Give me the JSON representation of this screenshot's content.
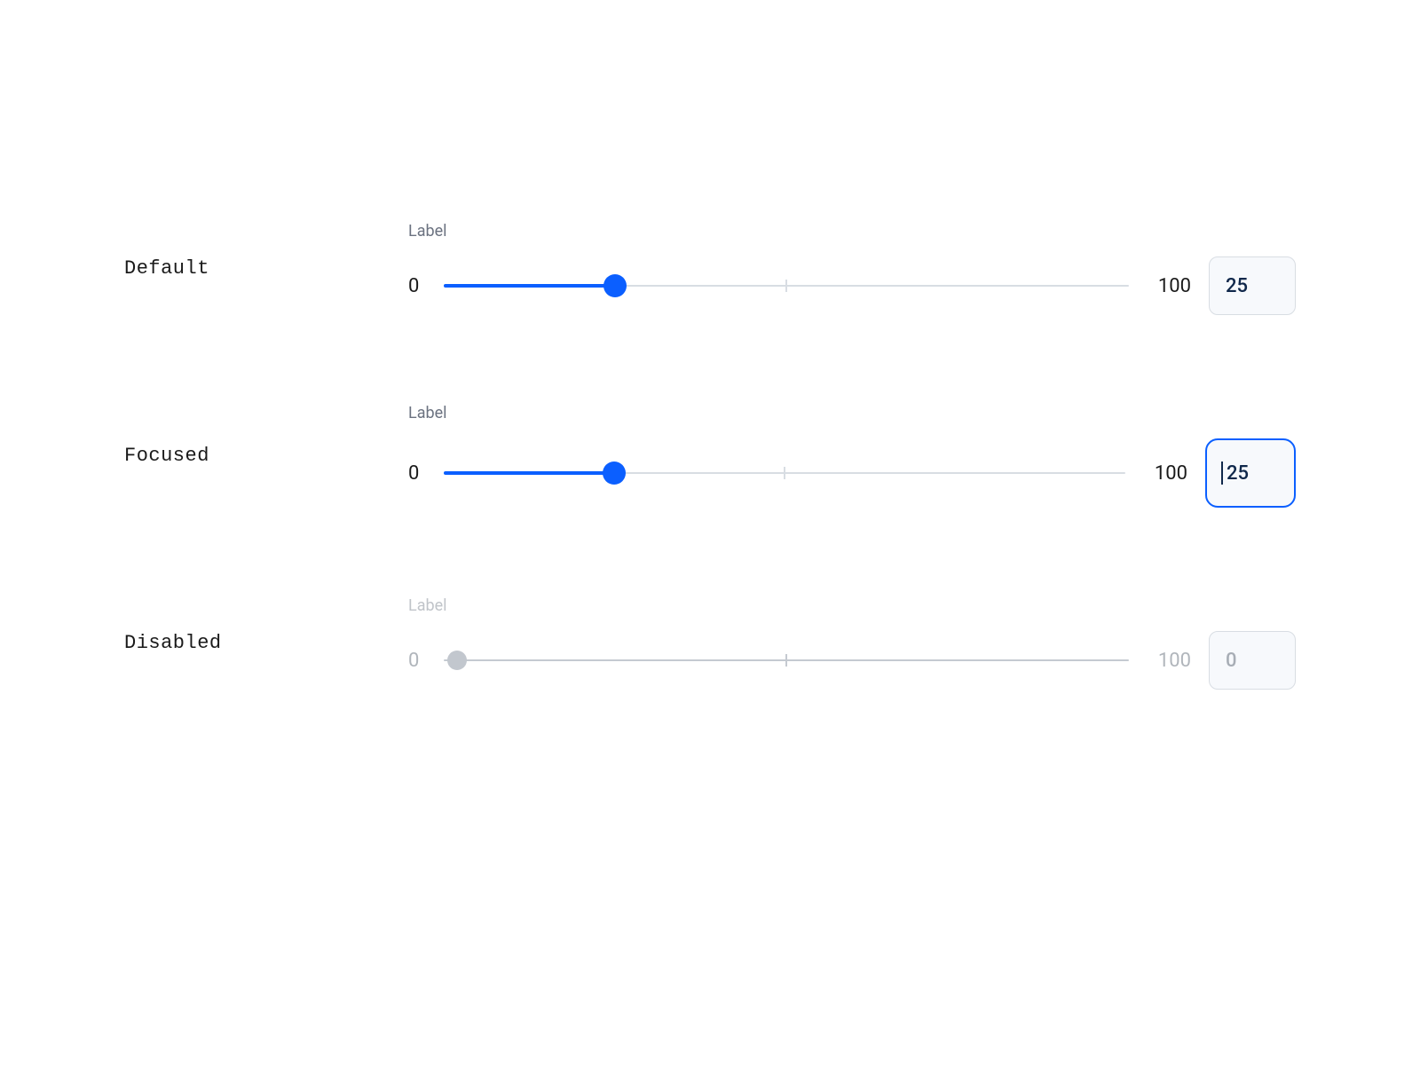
{
  "states": {
    "default": {
      "stateLabel": "Default",
      "fieldLabel": "Label",
      "min": "0",
      "max": "100",
      "value": "25",
      "percent": 25
    },
    "focused": {
      "stateLabel": "Focused",
      "fieldLabel": "Label",
      "min": "0",
      "max": "100",
      "value": "25",
      "percent": 25
    },
    "disabled": {
      "stateLabel": "Disabled",
      "fieldLabel": "Label",
      "min": "0",
      "max": "100",
      "value": "0",
      "percent": 0
    }
  },
  "colors": {
    "accent": "#0b5fff",
    "trackInactive": "#d8dde3",
    "disabledGray": "#c2c7ce",
    "textPrimary": "#1a1a1a",
    "textMuted": "#6b7280",
    "inputBg": "#f7f9fc",
    "inputText": "#10284b"
  }
}
